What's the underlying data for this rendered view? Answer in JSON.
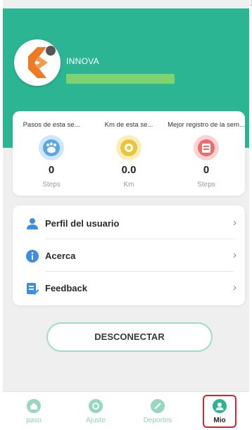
{
  "profile": {
    "name": "INNOVA"
  },
  "stats": [
    {
      "label": "Pasos de esta se...",
      "value": "0",
      "unit": "Steps",
      "icon": "footprints-icon",
      "color": "#5aa6e6"
    },
    {
      "label": "Km de esta se...",
      "value": "0.0",
      "unit": "Km",
      "icon": "distance-icon",
      "color": "#e8c53a"
    },
    {
      "label": "Mejor registro de la sem...",
      "value": "0",
      "unit": "Steps",
      "icon": "record-icon",
      "color": "#ee6b6b"
    }
  ],
  "menu": [
    {
      "label": "Perfil del usuario",
      "icon": "user-icon"
    },
    {
      "label": "Acerca",
      "icon": "info-icon"
    },
    {
      "label": "Feedback",
      "icon": "feedback-icon"
    }
  ],
  "disconnect_label": "DESCONECTAR",
  "tabs": [
    {
      "label": "paso",
      "icon": "home-icon"
    },
    {
      "label": "Ajuste",
      "icon": "settings-icon"
    },
    {
      "label": "Deportes",
      "icon": "sports-icon"
    },
    {
      "label": "Mio",
      "icon": "profile-icon",
      "active": true
    }
  ],
  "colors": {
    "accent": "#2bb592",
    "highlight": "#e0202c"
  }
}
